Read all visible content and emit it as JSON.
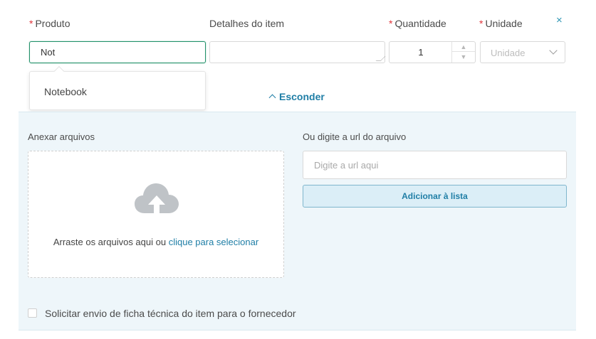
{
  "form": {
    "produto_label": "Produto",
    "detalhes_label": "Detalhes do item",
    "quantidade_label": "Quantidade",
    "unidade_label": "Unidade",
    "required_mark": "*",
    "produto_value": "Not",
    "detalhes_value": "",
    "quantidade_value": "1",
    "unidade_placeholder": "Unidade",
    "close_glyph": "×"
  },
  "autocomplete": {
    "options": [
      "Notebook"
    ]
  },
  "toggle": {
    "label": "Esconder"
  },
  "attachments": {
    "anexar_label": "Anexar arquivos",
    "drop_text": "Arraste os arquivos aqui ou ",
    "drop_link": "clique para selecionar",
    "url_label": "Ou digite a url do arquivo",
    "url_placeholder": "Digite a url aqui",
    "add_button": "Adicionar à lista"
  },
  "checkbox": {
    "label": "Solicitar envio de ficha técnica do item para o fornecedor",
    "checked": false
  },
  "colors": {
    "accent": "#1f7ea6",
    "required": "#e0353b",
    "focus_border": "#23916a",
    "panel_bg": "#eef6fa"
  }
}
